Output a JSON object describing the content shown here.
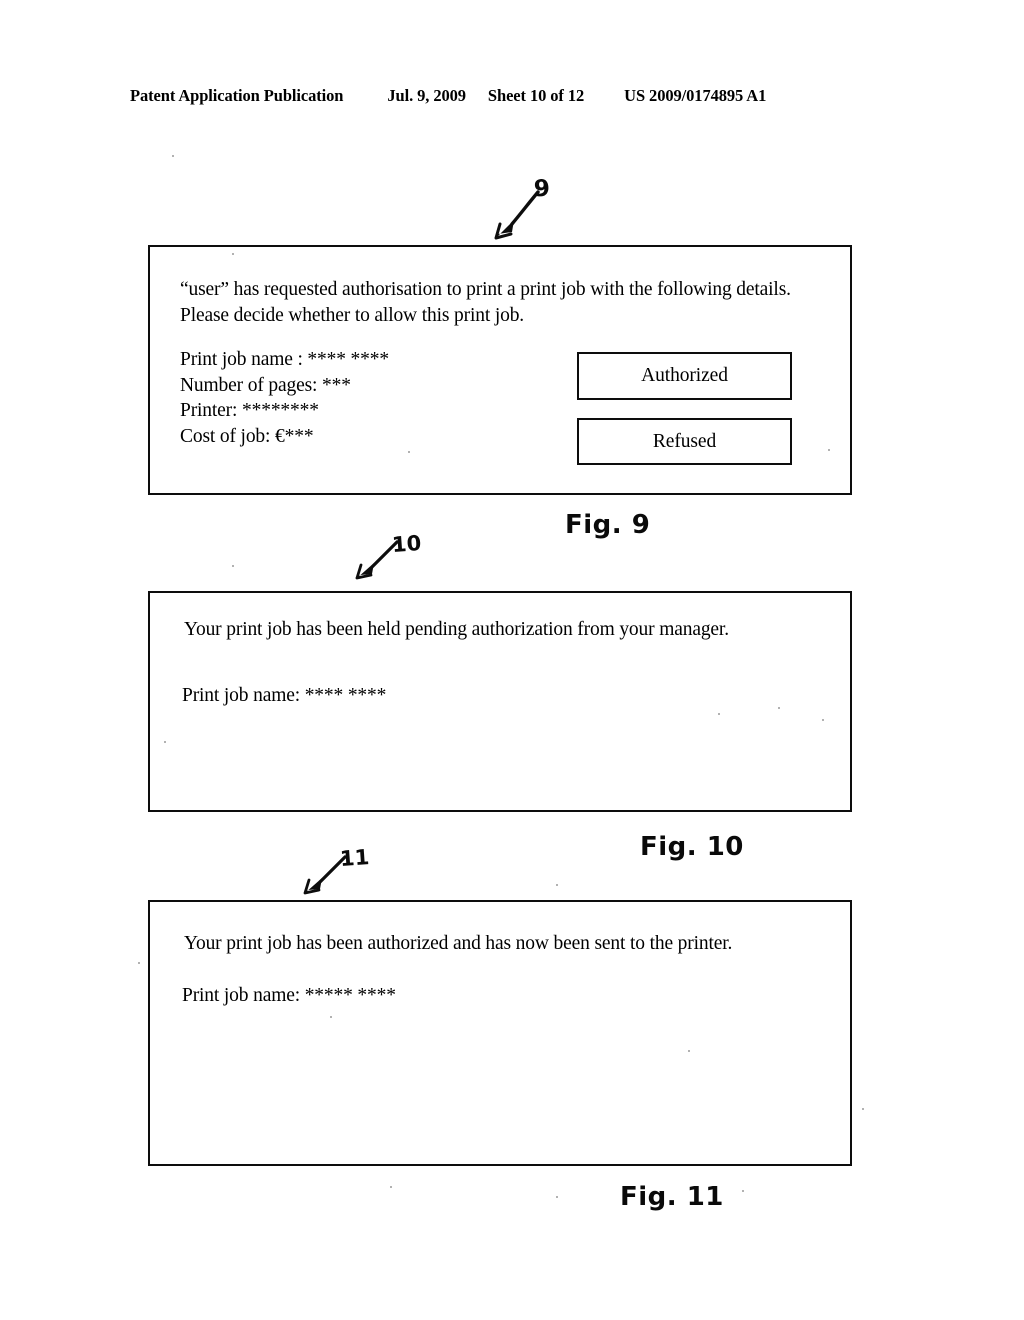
{
  "header": {
    "publication": "Patent Application Publication",
    "date": "Jul. 9, 2009",
    "sheet": "Sheet 10 of 12",
    "patent_number": "US 2009/0174895 A1"
  },
  "figures": [
    {
      "ref_label": "9",
      "caption": "Fig. 9",
      "prompt": "“user” has requested authorisation to print a print job with the following details. Please decide whether to allow this print job.",
      "details": [
        "Print job name : **** ****",
        "Number of pages: ***",
        "Printer: ********",
        "Cost of job: €***"
      ],
      "buttons": [
        {
          "label": "Authorized"
        },
        {
          "label": "Refused"
        }
      ]
    },
    {
      "ref_label": "10",
      "caption": "Fig. 10",
      "message": "Your print job has been held pending authorization from your manager.",
      "job_name": "Print job name: **** ****"
    },
    {
      "ref_label": "11",
      "caption": "Fig. 11",
      "message": "Your print job has been authorized and has now been sent to the printer.",
      "job_name": "Print job name: ***** ****"
    }
  ],
  "colors": {
    "ink": "#0d0d0d",
    "paper": "#ffffff"
  }
}
